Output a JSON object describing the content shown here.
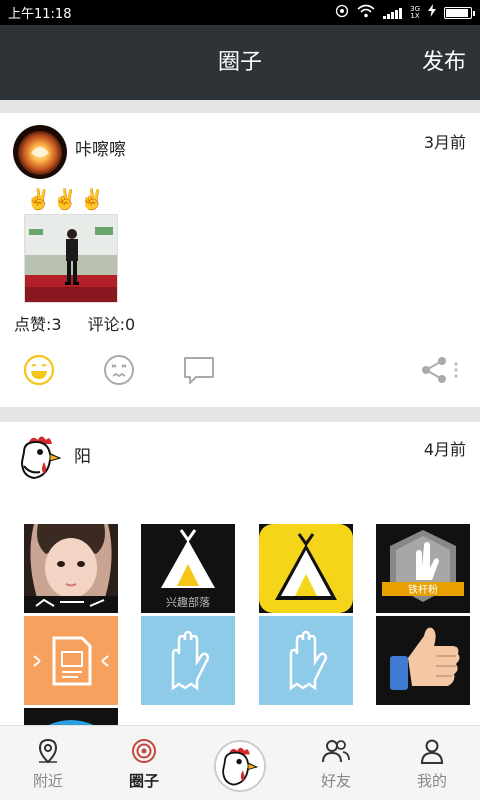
{
  "status_bar": {
    "time": "上午11:18",
    "network_label_top": "3G",
    "network_label_bottom": "1X"
  },
  "header": {
    "title": "圈子",
    "publish_label": "发布"
  },
  "posts": [
    {
      "user_name": "咔嚓嚓",
      "time": "3月前",
      "text": "✌️✌️✌️",
      "likes_label": "点赞:3",
      "comments_label": "评论:0"
    },
    {
      "user_name": "阳",
      "time": "4月前",
      "images": [
        {
          "caption": "",
          "icon": "selfie-photo"
        },
        {
          "caption": "兴趣部落",
          "icon": "tent-logo-black"
        },
        {
          "caption": "",
          "icon": "tent-logo-yellow"
        },
        {
          "caption": "铁杆粉",
          "icon": "hand-badge"
        },
        {
          "caption": "",
          "icon": "document-icon"
        },
        {
          "caption": "",
          "icon": "glove-icon"
        },
        {
          "caption": "",
          "icon": "glove-icon"
        },
        {
          "caption": "",
          "icon": "thumbs-up"
        }
      ]
    }
  ],
  "tabs": [
    {
      "label": "附近",
      "icon": "location-pin-icon"
    },
    {
      "label": "圈子",
      "icon": "circle-icon",
      "active": true
    },
    {
      "label": "",
      "icon": "rooster-avatar"
    },
    {
      "label": "好友",
      "icon": "friends-icon"
    },
    {
      "label": "我的",
      "icon": "person-icon"
    }
  ],
  "colors": {
    "header_bg": "#2e3338",
    "accent_yellow": "#f5c518",
    "active_tab_icon": "#c4453a",
    "muted": "#aaaaaa"
  }
}
